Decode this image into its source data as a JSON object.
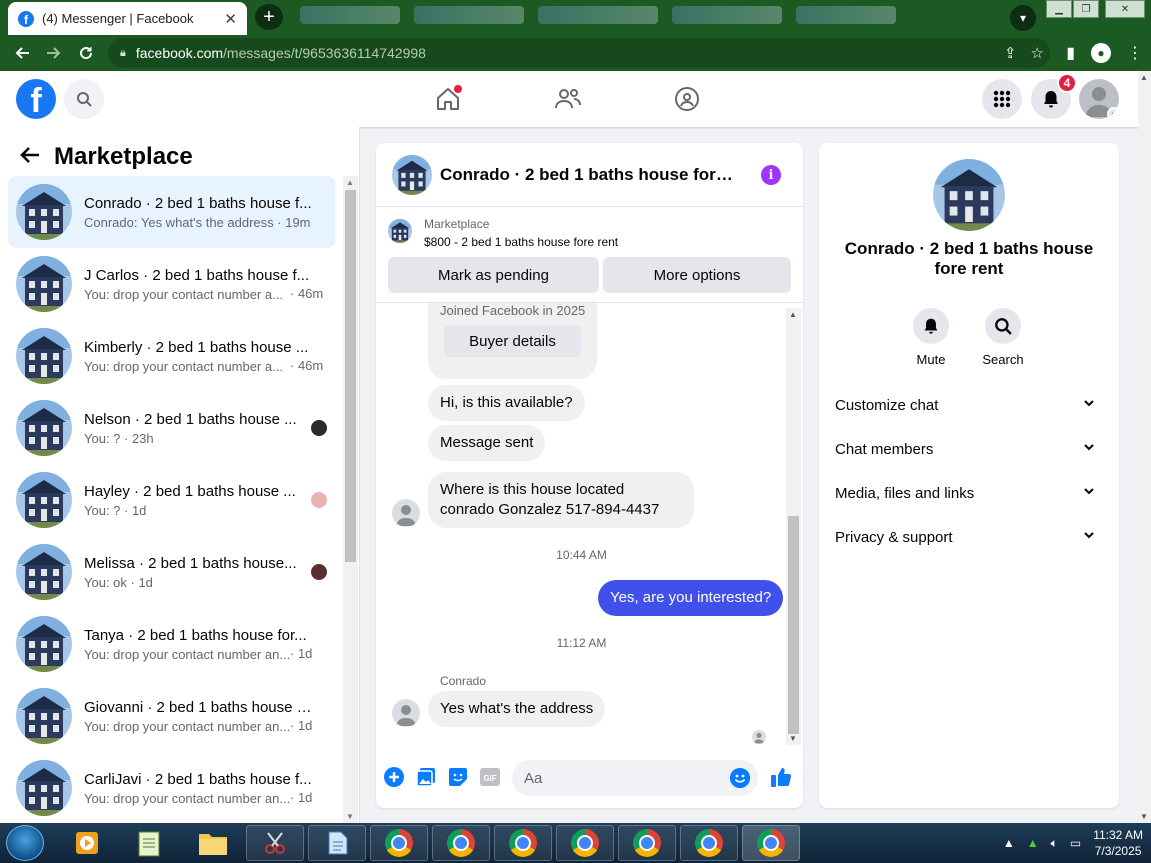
{
  "browser": {
    "tab_title": "(4) Messenger | Facebook",
    "tab_close": "✕",
    "url_host": "facebook.com",
    "url_path": "/messages/t/9653636114742998"
  },
  "header": {
    "notification_count": "4"
  },
  "sidebar": {
    "title": "Marketplace",
    "conversations": [
      {
        "name": "Conrado · 2 bed 1 baths house f...",
        "preview": "Conrado: Yes what's the address · 19m",
        "time": "",
        "active": true
      },
      {
        "name": "J Carlos · 2 bed 1 baths house f...",
        "preview": "You: drop your contact number a...",
        "time": "· 46m"
      },
      {
        "name": "Kimberly · 2 bed 1 baths house ...",
        "preview": "You: drop your contact number a...",
        "time": "· 46m"
      },
      {
        "name": "Nelson · 2 bed 1 baths house ...",
        "preview": "You: ? · 23h",
        "time": ""
      },
      {
        "name": "Hayley · 2 bed 1 baths house ...",
        "preview": "You: ? · 1d",
        "time": ""
      },
      {
        "name": "Melissa · 2 bed 1 baths house...",
        "preview": "You: ok · 1d",
        "time": ""
      },
      {
        "name": "Tanya · 2 bed 1 baths house for...",
        "preview": "You: drop your contact number an...",
        "time": "· 1d"
      },
      {
        "name": "Giovanni · 2 bed 1 baths house f...",
        "preview": "You: drop your contact number an...",
        "time": "· 1d"
      },
      {
        "name": "CarliJavi · 2 bed 1 baths house f...",
        "preview": "You: drop your contact number an...",
        "time": "· 1d"
      }
    ]
  },
  "chat": {
    "title": "Conrado · 2 bed 1 baths house fore r...",
    "marketplace_label": "Marketplace",
    "listing": "$800 - 2 bed 1 baths house fore rent",
    "mark_pending": "Mark as pending",
    "more_options": "More options",
    "joined": "Joined Facebook in 2025",
    "buyer_details": "Buyer details",
    "msg1": "Hi, is this available?",
    "msg2": "Message sent",
    "msg3": "Where is this house located conrado Gonzalez 517-894-4437",
    "ts1": "10:44 AM",
    "msg_out": "Yes, are you interested?",
    "ts2": "11:12 AM",
    "sender": "Conrado",
    "msg4": "Yes what's the address",
    "composer_placeholder": "Aa"
  },
  "info": {
    "name": "Conrado · 2 bed 1 baths house fore rent",
    "mute": "Mute",
    "search": "Search",
    "sections": [
      "Customize chat",
      "Chat members",
      "Media, files and links",
      "Privacy & support"
    ]
  },
  "taskbar": {
    "time": "11:32 AM",
    "date": "7/3/2025"
  },
  "colors": {
    "brand": "#1877f2",
    "chrome_frame": "#1c5a23",
    "outgoing_bubble": "#3f51ea",
    "active_conversation": "#e7f3ff"
  }
}
